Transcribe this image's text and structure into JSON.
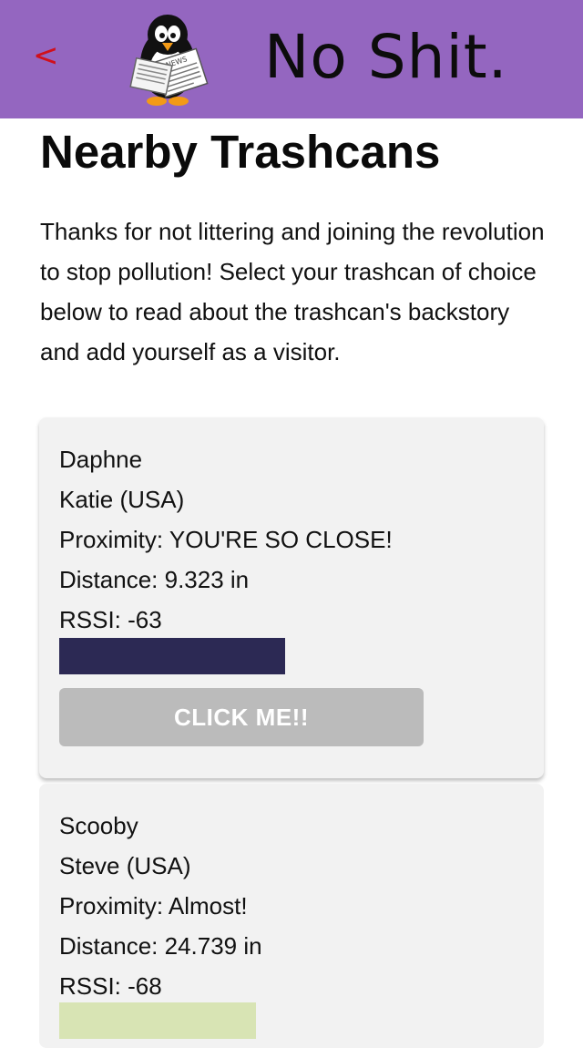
{
  "header": {
    "back_label": "<",
    "brand": "No Shit.",
    "logo_badge": "NEWS",
    "colors": {
      "bar": "#9466c0",
      "back": "#d0101c"
    }
  },
  "page": {
    "title": "Nearby Trashcans",
    "intro": "Thanks for not littering and joining the revolution to stop pollution! Select your trashcan of choice below to read about the trashcan's backstory and add yourself as a visitor."
  },
  "trashcans": [
    {
      "name": "Daphne",
      "owner": "Katie (USA)",
      "proximity": "Proximity: YOU'RE SO CLOSE!",
      "distance": "Distance: 9.323 in",
      "rssi": "RSSI: -63",
      "signal_fraction": 0.62,
      "signal_color": "#2c2954",
      "button_label": "CLICK ME!!"
    },
    {
      "name": "Scooby",
      "owner": "Steve (USA)",
      "proximity": "Proximity: Almost!",
      "distance": "Distance: 24.739 in",
      "rssi": "RSSI: -68",
      "signal_fraction": 0.54,
      "signal_color": "#d8e4b4"
    }
  ]
}
